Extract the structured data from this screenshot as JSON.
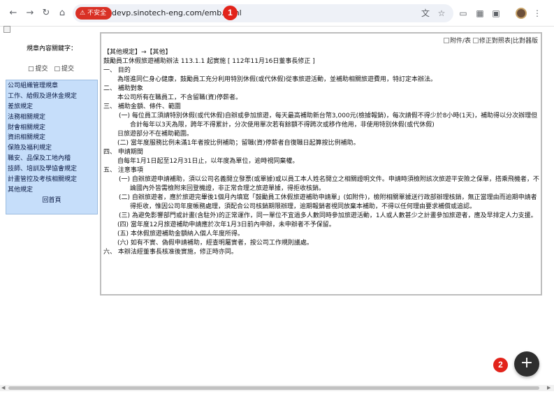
{
  "browser": {
    "security_label": "不安全",
    "url": "devp.sinotech-eng.com/emb.html",
    "annotation_1": "1",
    "annotation_2": "2"
  },
  "sidebar": {
    "keyword_label": "規章內容關鍵字：",
    "submit_1": "提交",
    "submit_2": "提交",
    "menu": [
      "公司組織管理規章",
      "工作、給假及退休金規定",
      "差旅規定",
      "法務相關規定",
      "財會相關規定",
      "資訊相關規定",
      "保險及福利規定",
      "職安、品保及工地內稽",
      "技師、培訓及學協會規定",
      "計畫管控及考核相關規定",
      "其他規定"
    ],
    "home": "回首頁"
  },
  "content": {
    "links": {
      "attachment": "附件/表",
      "revision": "修正對照表",
      "compare": "比對器版"
    },
    "breadcrumb": "【其他規定】→【其他】",
    "title": "鼓勵員工休假旅遊補助辦法 113.1.1 起實施 [ 112年11月16日董事長修正 ]",
    "lines": [
      "一、 目的",
      "為增進同仁身心健康，鼓勵員工充分利用特別休假(或代休假)從事旅遊活動，並補助相關旅遊費用，特訂定本辦法。",
      "二、 補助對象",
      "本公司所有在職員工，不含留職(資)停薪者。",
      "三、 補助金額、條件、範圍",
      "(一) 每位員工須請特別休假(或代休假)自辦或參加旅遊，每天最高補助新台幣3,000元(檢據報銷)，每次請假不得少於8小時(1天)，補助得以分次辦理但合計每年以3天為限，跨年不得累計，分次使用單次若有餘額不得跨次或移作他用，非使用特別休假(或代休假)",
      "日旅遊部分不在補助範圍。",
      "(二) 當年度服務比例未滿1年者按比例補助；留職(資)停薪者自復職日起算按比例補助。",
      "四、 申請期間",
      "自每年1月1日起至12月31日止，以年度為單位，逾時視同棄權。",
      "五、 注意事項",
      "(一) 自辦旅遊申請補助，須以公司名義開立發票(或單據)或以員工本人姓名開立之相關證明文件。申請時須檢附該次旅遊平安險之保單，搭乘飛機者，不論國內外皆需檢附來回登機證，非正常合理之旅遊單據，得拒收核銷。",
      "(二) 自辦旅遊者，應於旅遊完畢後1個月內填寫「鼓勵員工休假旅遊補助申請單」(如附件)，檢附相關單據送行政部辦理核銷，無正當理由而逾期申請者得拒收，惟因公司年度帳務處理，須配合公司核銷期限辦理，逾期報銷者視同放棄本補助，不得以任何理由要求補償或追認。",
      "(三) 為避免影響部門或計畫(含駐外)的正常運作，同一單位不宜過多人數同時參加旅遊活動，1人或人數甚少之計畫參加旅遊者，應及早排定人力支援。",
      "(四) 當年度12月旅遊補助申請應於次年1月3日前內申辦，未申辦者不予保留。",
      "(五) 本休假旅遊補助金額納入個人年度所得。",
      "(六) 如有不實、偽假申請補助，經查明屬實者，按公司工作規則議處。",
      "六、 本辦法經董事長核准後實施，修正時亦同。"
    ]
  }
}
